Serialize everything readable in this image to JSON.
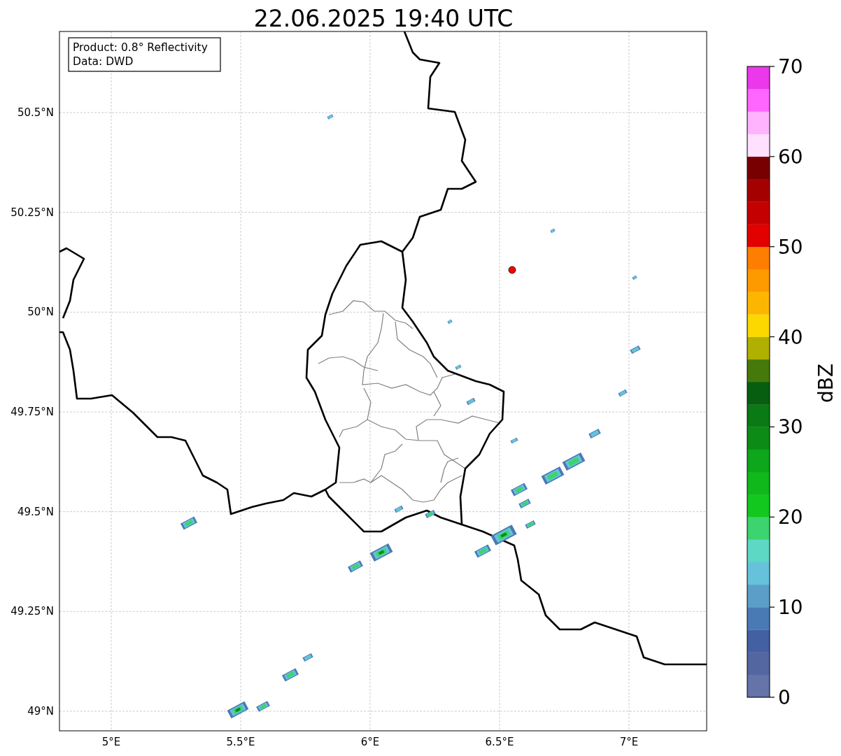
{
  "title": "22.06.2025 19:40 UTC",
  "info_box": {
    "lines": [
      "Product: 0.8° Reflectivity",
      "Data: DWD"
    ]
  },
  "x_axis": {
    "ticks": [
      "5°E",
      "5.5°E",
      "6°E",
      "6.5°E",
      "7°E"
    ]
  },
  "y_axis": {
    "ticks": [
      "50.5°N",
      "50.25°N",
      "50°N",
      "49.75°N",
      "49.5°N",
      "49.25°N",
      "49°N"
    ]
  },
  "colorbar": {
    "label": "dBZ",
    "ticks": [
      "70",
      "60",
      "50",
      "40",
      "30",
      "20",
      "10",
      "0"
    ],
    "segments": [
      {
        "color": "#6473a8"
      },
      {
        "color": "#5466a0"
      },
      {
        "color": "#4360a3"
      },
      {
        "color": "#4a7ab4"
      },
      {
        "color": "#5b9ec8"
      },
      {
        "color": "#66c2db"
      },
      {
        "color": "#5dd8c4"
      },
      {
        "color": "#3cd46e"
      },
      {
        "color": "#12c81e"
      },
      {
        "color": "#10b81c"
      },
      {
        "color": "#0ea61a"
      },
      {
        "color": "#0c8c16"
      },
      {
        "color": "#0a7a14"
      },
      {
        "color": "#075e10"
      },
      {
        "color": "#457a0a"
      },
      {
        "color": "#b0b000"
      },
      {
        "color": "#fcd800"
      },
      {
        "color": "#fdb600"
      },
      {
        "color": "#fd9a00"
      },
      {
        "color": "#fd7e00"
      },
      {
        "color": "#e20000"
      },
      {
        "color": "#c40000"
      },
      {
        "color": "#a50000"
      },
      {
        "color": "#780000"
      },
      {
        "color": "#ffe0ff"
      },
      {
        "color": "#ffb3ff"
      },
      {
        "color": "#ff66ff"
      },
      {
        "color": "#ea38ea"
      }
    ]
  }
}
